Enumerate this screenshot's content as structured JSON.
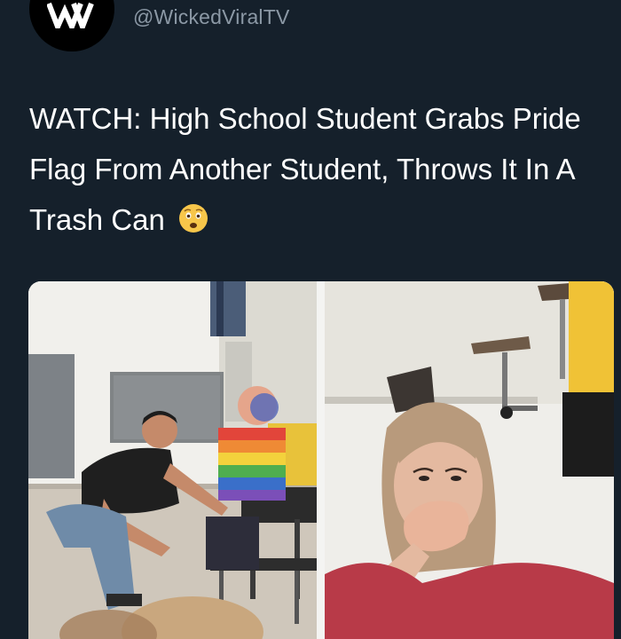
{
  "account": {
    "handle": "@WickedViralTV",
    "avatar_icon": "wicked-viral-logo-icon"
  },
  "tweet": {
    "headline": "WATCH: High School Student Grabs Pride Flag From Another Student, Throws It In A Trash Can",
    "emoji_icon": "astonished-face-emoji-icon"
  },
  "media": {
    "left_image": "classroom-students-photo",
    "right_image": "girl-covering-mouth-photo"
  },
  "colors": {
    "background": "#15202b",
    "handle_text": "#8b98a5",
    "headline_text": "#ffffff"
  }
}
